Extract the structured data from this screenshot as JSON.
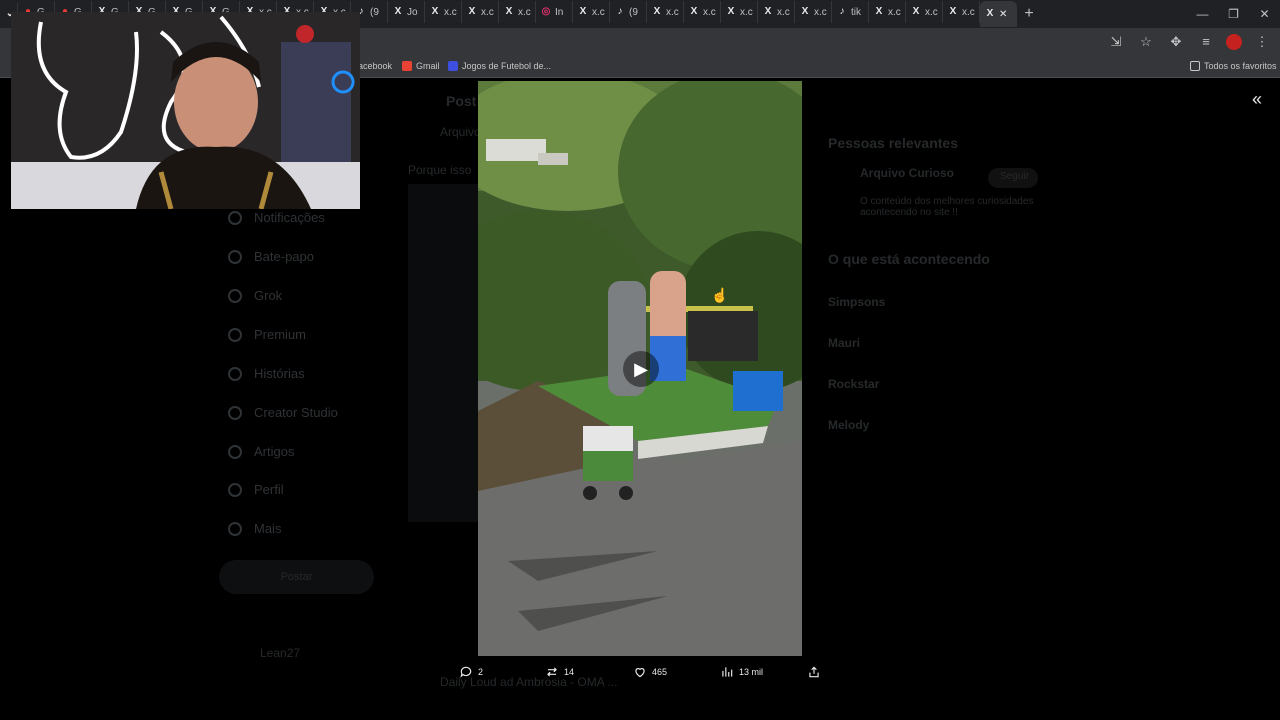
{
  "tabs": [
    {
      "label": "G",
      "icon": "red-dot-icon"
    },
    {
      "label": "G",
      "icon": "red-dot-icon"
    },
    {
      "label": "G",
      "icon": "x-icon"
    },
    {
      "label": "G",
      "icon": "x-icon"
    },
    {
      "label": "G",
      "icon": "x-icon"
    },
    {
      "label": "G",
      "icon": "x-icon"
    },
    {
      "label": "x.c",
      "icon": "x-icon"
    },
    {
      "label": "x.c",
      "icon": "x-icon"
    },
    {
      "label": "x.c",
      "icon": "x-icon"
    },
    {
      "label": "(9",
      "icon": "tiktok-icon"
    },
    {
      "label": "Jo",
      "icon": "x-icon"
    },
    {
      "label": "x.c",
      "icon": "x-icon"
    },
    {
      "label": "x.c",
      "icon": "x-icon"
    },
    {
      "label": "x.c",
      "icon": "x-icon"
    },
    {
      "label": "In",
      "icon": "instagram-icon"
    },
    {
      "label": "x.c",
      "icon": "x-icon"
    },
    {
      "label": "(9",
      "icon": "tiktok-icon"
    },
    {
      "label": "x.c",
      "icon": "x-icon"
    },
    {
      "label": "x.c",
      "icon": "x-icon"
    },
    {
      "label": "x.c",
      "icon": "x-icon"
    },
    {
      "label": "x.c",
      "icon": "x-icon"
    },
    {
      "label": "x.c",
      "icon": "x-icon"
    },
    {
      "label": "tik",
      "icon": "tiktok-icon"
    },
    {
      "label": "x.c",
      "icon": "x-icon"
    },
    {
      "label": "x.c",
      "icon": "x-icon"
    },
    {
      "label": "x.c",
      "icon": "x-icon"
    }
  ],
  "bookmarks": {
    "facebook": "acebook",
    "gmail": "Gmail",
    "jogos": "Jogos de Futebol de...",
    "all": "Todos os favoritos"
  },
  "sidebar": {
    "items": [
      "Notificações",
      "Bate-papo",
      "Grok",
      "Premium",
      "Histórias",
      "Creator Studio",
      "Artigos",
      "Perfil",
      "Mais"
    ],
    "post_button": "Postar",
    "account": "Lean27"
  },
  "background_page": {
    "post_header": "Post",
    "post_author": "Arquivo",
    "post_text": "Porque isso",
    "relevant_people": "Pessoas relevantes",
    "relevant_name": "Arquivo Curioso",
    "follow": "Seguir",
    "relevant_bio": "O conteúdo dos melhores curiosidades acontecendo no site !!",
    "whats_happening": "O que está acontecendo",
    "trends": [
      "Simpsons",
      "Mauri",
      "Rockstar",
      "Melody"
    ],
    "bottom_author": "Daily Loud ad Ambrosia - OMA ..."
  },
  "actions": {
    "replies": "2",
    "reposts": "14",
    "likes": "465",
    "views": "13 mil"
  },
  "colors": {
    "chrome_bg": "#202124",
    "toolbar_bg": "#35363a",
    "page_bg": "#000000",
    "text": "#e7e9ea"
  }
}
